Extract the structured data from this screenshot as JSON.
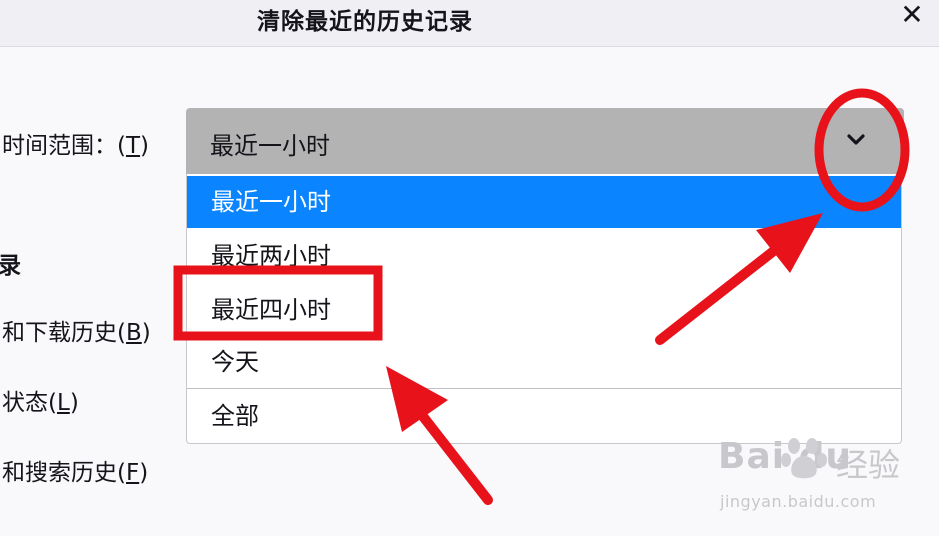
{
  "dialog": {
    "title": "清除最近的历史记录",
    "close_glyph": "✕"
  },
  "time_range": {
    "label": "时间范围：(",
    "accesskey": "T",
    "label_suffix": ")",
    "selected": "最近一小时",
    "options": [
      "最近一小时",
      "最近两小时",
      "最近四小时",
      "今天",
      "全部"
    ]
  },
  "history_section": {
    "heading_fragment": "录",
    "items": [
      {
        "text": "和下载历史(",
        "key": "B",
        "suffix": ")"
      },
      {
        "text": "状态(",
        "key": "L",
        "suffix": ")"
      },
      {
        "text": "和搜索历史(",
        "key": "F",
        "suffix": ")"
      }
    ]
  },
  "annotation": {
    "color": "#e8131a"
  },
  "watermark": {
    "logo": "Bai du",
    "brand_cn": "经验",
    "url": "jingyan.baidu.com"
  },
  "icons": {
    "dropdown": "chevron-down-icon",
    "close": "close-icon"
  }
}
